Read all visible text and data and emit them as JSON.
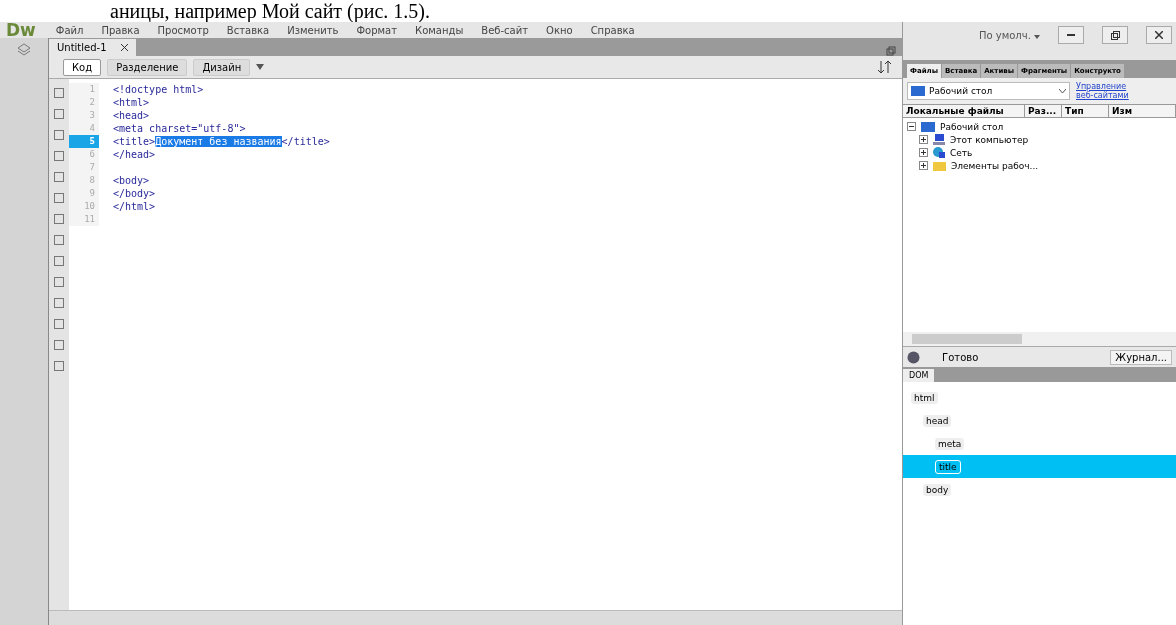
{
  "page_caption": "аницы, например Мой сайт (рис. 1.5).",
  "app": {
    "logo": "Dw",
    "menu": [
      "Файл",
      "Правка",
      "Просмотр",
      "Вставка",
      "Изменить",
      "Формат",
      "Команды",
      "Веб-сайт",
      "Окно",
      "Справка"
    ],
    "workspace": "По умолч."
  },
  "document_tabs": [
    {
      "label": "Untitled-1",
      "selected": true
    }
  ],
  "view_buttons": [
    {
      "label": "Код",
      "selected": true
    },
    {
      "label": "Разделение",
      "selected": false
    },
    {
      "label": "Дизайн",
      "selected": false
    }
  ],
  "code_lines": [
    {
      "number": "1",
      "current": false,
      "segments": [
        {
          "text": "<!doctype html>",
          "selected": false
        }
      ]
    },
    {
      "number": "2",
      "current": false,
      "segments": [
        {
          "text": "<html>",
          "selected": false
        }
      ]
    },
    {
      "number": "3",
      "current": false,
      "segments": [
        {
          "text": "<head>",
          "selected": false
        }
      ]
    },
    {
      "number": "4",
      "current": false,
      "segments": [
        {
          "text": "<meta charset=\"utf-8\">",
          "selected": false
        }
      ]
    },
    {
      "number": "5",
      "current": true,
      "segments": [
        {
          "text": "<title>",
          "selected": false
        },
        {
          "text": "Документ без названия",
          "selected": true
        },
        {
          "text": "</title>",
          "selected": false
        }
      ]
    },
    {
      "number": "6",
      "current": false,
      "segments": [
        {
          "text": "</head>",
          "selected": false
        }
      ]
    },
    {
      "number": "7",
      "current": false
    },
    {
      "number": "8",
      "current": false,
      "segments": [
        {
          "text": "<body>",
          "selected": false
        }
      ]
    },
    {
      "number": "9",
      "current": false,
      "segments": [
        {
          "text": "</body>",
          "selected": false
        }
      ]
    },
    {
      "number": "10",
      "current": false,
      "segments": [
        {
          "text": "</html>",
          "selected": false
        }
      ]
    },
    {
      "number": "11",
      "current": false
    }
  ],
  "files_panel": {
    "tabs": [
      {
        "label": "Файлы",
        "selected": true
      },
      {
        "label": "Вставка",
        "selected": false
      },
      {
        "label": "Активы",
        "selected": false
      },
      {
        "label": "Фрагменты",
        "selected": false
      },
      {
        "label": "Конструкто",
        "selected": false
      }
    ],
    "site": "Рабочий стол",
    "manage_link": "Управление веб-сайтами",
    "columns": [
      "Локальные файлы",
      "Раз...",
      "Тип",
      "Изм"
    ],
    "tree": [
      {
        "label": "Рабочий стол",
        "kind": "desktop",
        "expanded": true,
        "children": [
          {
            "label": "Этот компьютер",
            "kind": "computer",
            "expanded": false
          },
          {
            "label": "Сеть",
            "kind": "network",
            "expanded": false
          },
          {
            "label": "Элементы рабоч...",
            "kind": "folder",
            "expanded": false
          }
        ]
      }
    ],
    "status": "Готово",
    "log_button": "Журнал..."
  },
  "dom_panel": {
    "tab": "DOM",
    "tree": [
      {
        "label": "html",
        "selected": false,
        "children": [
          {
            "label": "head",
            "selected": false,
            "children": [
              {
                "label": "meta",
                "selected": false
              },
              {
                "label": "title",
                "selected": true
              }
            ]
          },
          {
            "label": "body",
            "selected": false
          }
        ]
      }
    ]
  }
}
